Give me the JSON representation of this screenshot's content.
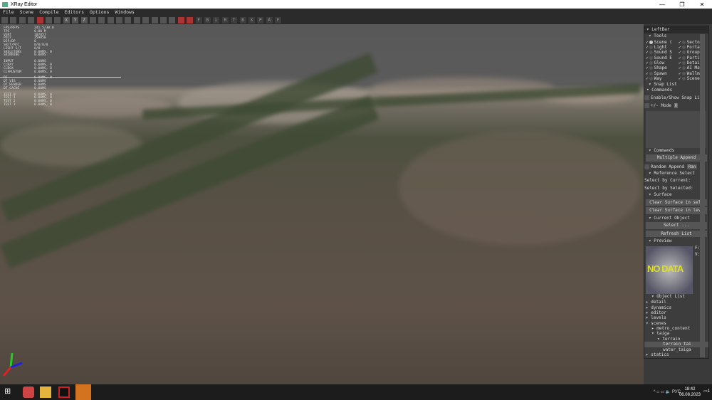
{
  "window": {
    "title": "XRay Editor",
    "controls": [
      "—",
      "❐",
      "✕"
    ]
  },
  "menu": [
    "File",
    "Scene",
    "Compile",
    "Editors",
    "Options",
    "Windows"
  ],
  "toolbar": {
    "icons": [
      "arrow-left",
      "arrow-right",
      "select",
      "small",
      "move-red",
      "rotate",
      "scale",
      "x",
      "y",
      "z",
      "lock",
      "bracket",
      "snap",
      "grid",
      "obj1",
      "obj2",
      "obj3",
      "obj4",
      "obj5",
      "obj6",
      "snap-red1",
      "snap-red2"
    ],
    "view_buttons": [
      "F",
      "B",
      "L",
      "R",
      "T",
      "B",
      "X",
      "P",
      "A",
      "F"
    ]
  },
  "stats": [
    {
      "k": "FPS/RFPS",
      "v": "241.5/30.0"
    },
    {
      "k": "TPS",
      "v": "0.00 M"
    },
    {
      "k": "VERT",
      "v": "107857"
    },
    {
      "k": "POLY",
      "v": "359858"
    },
    {
      "k": "DIP/DP",
      "v": "6"
    },
    {
      "k": "SH/T/M/C",
      "v": "0/0/0/0"
    },
    {
      "k": "LIGHT S/T",
      "v": "0/0"
    },
    {
      "k": "SKELETONS",
      "v": "0.00MS, 0"
    },
    {
      "k": "SKINNING",
      "v": "0.00MS"
    },
    {
      "k": "",
      "v": ""
    },
    {
      "k": "INPUT",
      "v": "0.00MS"
    },
    {
      "k": "CLRAY",
      "v": "0.00MS, 0"
    },
    {
      "k": "CLBOX",
      "v": "0.00MS, 0"
    },
    {
      "k": "CLFRUSTUM",
      "v": "0.00MS, 0"
    },
    {
      "k": "",
      "v": ""
    },
    {
      "k": "RT",
      "v": "0.00MS, 0"
    },
    {
      "k": "DT_VIS",
      "v": "0.00MS"
    },
    {
      "k": "DT_RENDER",
      "v": "0.00MS"
    },
    {
      "k": "DT_CACHE",
      "v": "0.00MS"
    },
    {
      "k": "",
      "v": ""
    },
    {
      "k": "TEST 0",
      "v": "0.00MS, 0"
    },
    {
      "k": "TEST 1",
      "v": "0.00MS, 0"
    },
    {
      "k": "TEST 2",
      "v": "0.00MS, 0"
    },
    {
      "k": "TEST 3",
      "v": "0.00MS, 0"
    }
  ],
  "panel": {
    "title": "LeftBar",
    "tools_label": "Tools",
    "tools": [
      "Scene (",
      "Sector",
      "Light",
      "Portal",
      "Sound S",
      "Group",
      "Sound E",
      "Particl",
      "Glow",
      "Detail",
      "Shape",
      "AI Map",
      "Spawn",
      "Wallmar",
      "Way",
      "Scene E"
    ],
    "snap_list": "Snap List",
    "commands": "Commands",
    "enable_snap": "Enable/Show Snap Lis",
    "mode": "+/- Mode",
    "mode_x": "X",
    "commands2": "Commands",
    "multiple_append": "Multiple Append",
    "random_append": "Random Append",
    "ran": "Ran",
    "reference_select": "Reference Select",
    "select_by_current": "Select by Current:",
    "select_by_selected": "Select by Selected:",
    "surface": "Surface",
    "clear_sel": "Clear Surface in sele",
    "clear_level": "Clear Surface in leve",
    "current_object": "Current Object",
    "select": "Select ...",
    "refresh": "Refresh List",
    "preview": "Preview",
    "no_data": "NO DATA",
    "preview_side": [
      "F:",
      "V:"
    ],
    "object_list": "Object List",
    "tree": [
      {
        "t": "▸ detail",
        "d": 0
      },
      {
        "t": "▸ dynamics",
        "d": 0
      },
      {
        "t": "▸ editor",
        "d": 0
      },
      {
        "t": "▸ levels",
        "d": 0
      },
      {
        "t": "▾ scenes",
        "d": 0
      },
      {
        "t": "▸ metro_content",
        "d": 1
      },
      {
        "t": "▾ taiga",
        "d": 1
      },
      {
        "t": "▾ terrain",
        "d": 2
      },
      {
        "t": "terrain_tai",
        "d": 3,
        "selected": true
      },
      {
        "t": "water_taiga",
        "d": 3
      },
      {
        "t": "▸ statics",
        "d": 0
      }
    ]
  },
  "taskbar": {
    "lang": "РУС",
    "time": "18:42",
    "date": "06.08.2023",
    "notif": "1"
  }
}
